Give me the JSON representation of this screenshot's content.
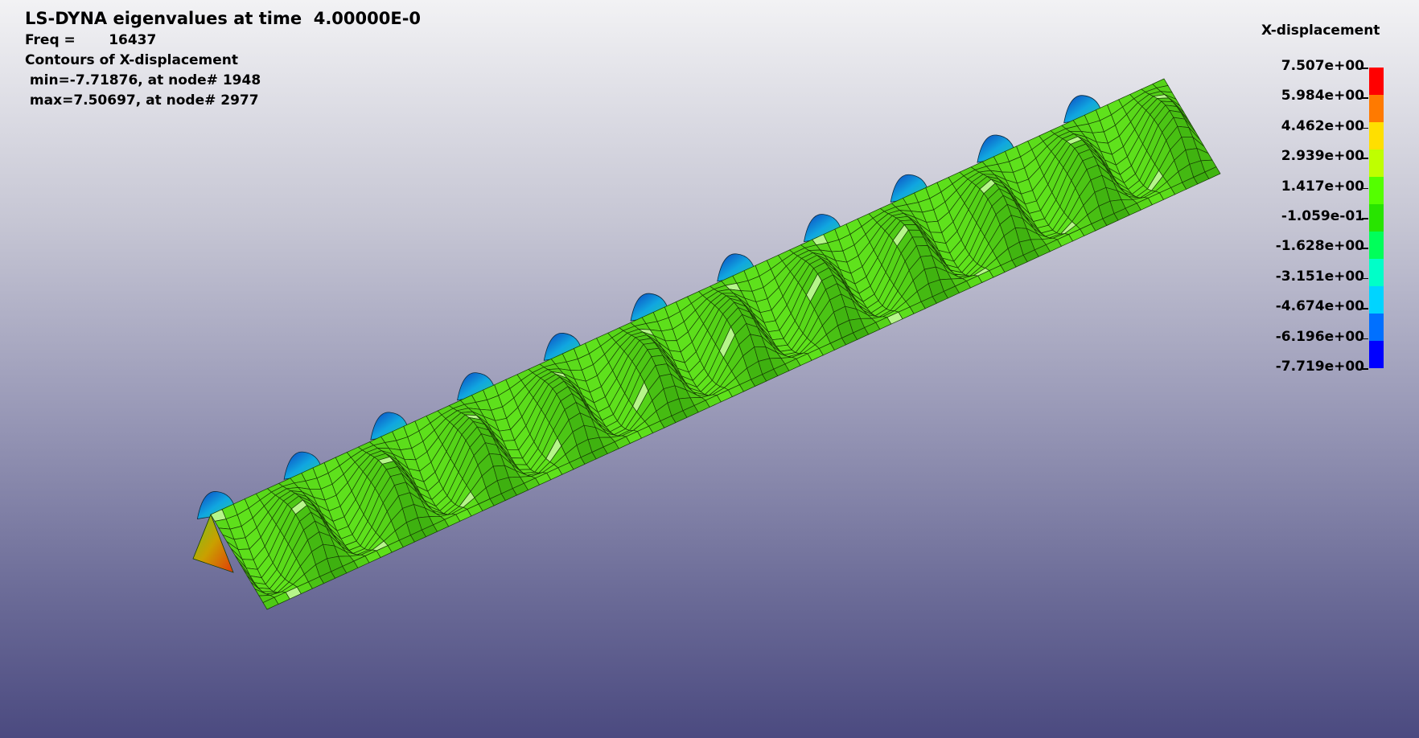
{
  "header": {
    "title": "LS-DYNA eigenvalues at time  4.00000E-0",
    "freq_label": "Freq =       16437",
    "contour_label": "Contours of X-displacement",
    "min_text": " min=-7.71876, at node# 1948",
    "max_text": " max=7.50697, at node# 2977"
  },
  "legend": {
    "title": "X-displacement",
    "labels": [
      "7.507e+00",
      "5.984e+00",
      "4.462e+00",
      "2.939e+00",
      "1.417e+00",
      "-1.059e-01",
      "-1.628e+00",
      "-3.151e+00",
      "-4.674e+00",
      "-6.196e+00",
      "-7.719e+00"
    ],
    "colors": [
      "#ff0000",
      "#ff7a00",
      "#ffdf00",
      "#bfff00",
      "#54ff00",
      "#28e400",
      "#00ff5a",
      "#00ffc8",
      "#00d4ff",
      "#0070ff",
      "#0000ff"
    ]
  },
  "model": {
    "mesh_color": "#5fe21c",
    "mesh_color_dark": "#2f9a0a",
    "mesh_highlight": "#b6f58a",
    "bump_colors": [
      "#0d3fbf",
      "#10a6e0",
      "#26d29a"
    ],
    "corner_colors": [
      "#e23a0a",
      "#c9a000",
      "#6fc71f"
    ]
  }
}
